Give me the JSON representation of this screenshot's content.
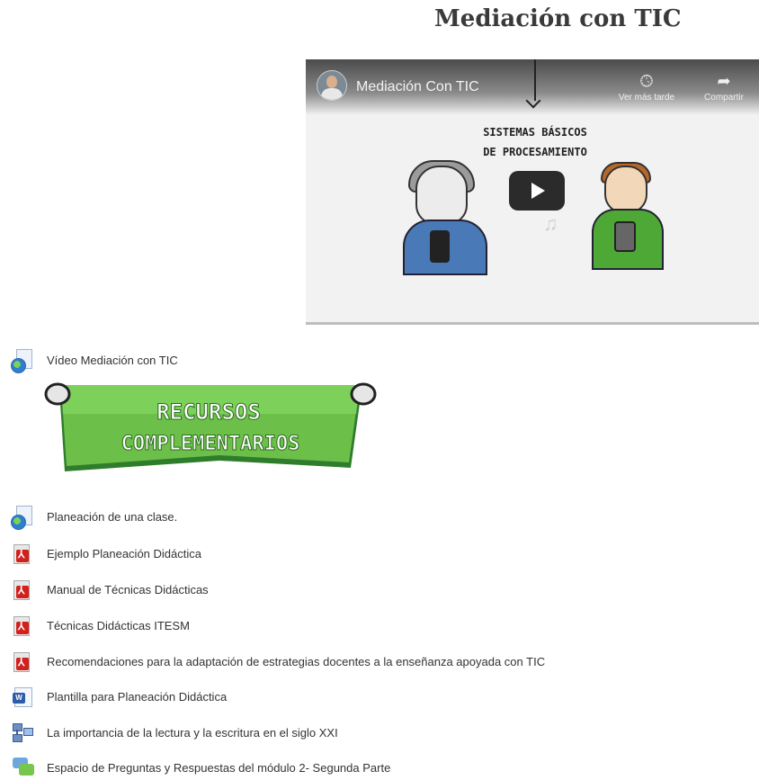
{
  "page": {
    "title": "Mediación con TIC"
  },
  "video": {
    "title": "Mediación Con TIC",
    "watch_later_label": "Ver más tarde",
    "share_label": "Compartir",
    "slide_text_line1": "SISTEMAS BÁSICOS",
    "slide_text_line2": "DE PROCESAMIENTO",
    "accent_color": "#2b2b2b"
  },
  "main_resources": [
    {
      "icon": "url-globe-icon",
      "label": "Vídeo Mediación con TIC"
    }
  ],
  "banner": {
    "line1": "RECURSOS",
    "line2": "COMPLEMENTARIOS",
    "color": "#6cc04a"
  },
  "complementary_resources": [
    {
      "icon": "url-globe-icon",
      "label": "Planeación de una clase."
    },
    {
      "icon": "pdf-icon",
      "label": "Ejemplo Planeación Didáctica"
    },
    {
      "icon": "pdf-icon",
      "label": "Manual de Técnicas Didácticas"
    },
    {
      "icon": "pdf-icon",
      "label": "Técnicas Didácticas ITESM"
    },
    {
      "icon": "pdf-icon",
      "label": "Recomendaciones para la adaptación de estrategias docentes a la enseñanza apoyada con TIC"
    },
    {
      "icon": "word-document-icon",
      "label": "Plantilla para Planeación Didáctica"
    },
    {
      "icon": "book-structure-icon",
      "label": "La importancia de la lectura y la escritura en el siglo XXI"
    },
    {
      "icon": "forum-icon",
      "label": "Espacio de Preguntas y Respuestas del módulo 2- Segunda Parte"
    }
  ]
}
